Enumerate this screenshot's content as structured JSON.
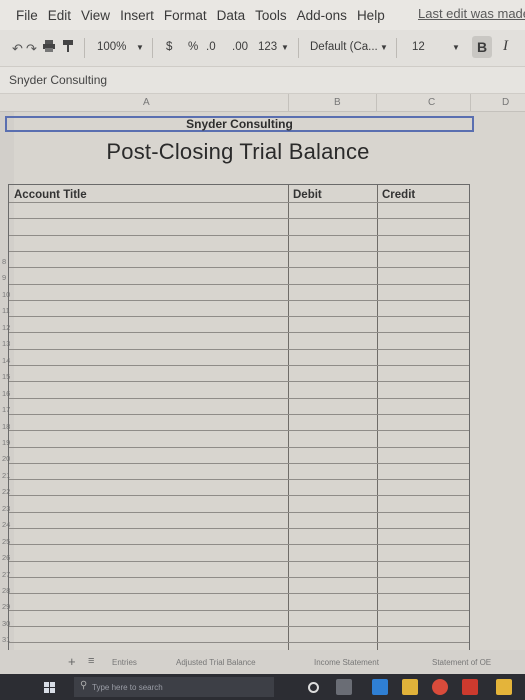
{
  "menu": {
    "items": [
      "File",
      "Edit",
      "View",
      "Insert",
      "Format",
      "Data",
      "Tools",
      "Add-ons",
      "Help"
    ],
    "last_edit": "Last edit was made"
  },
  "toolbar": {
    "zoom": "100%",
    "currency": "$",
    "percent": "%",
    "decrease_decimal": ".0",
    "increase_decimal": ".00",
    "number_format": "123",
    "font": "Default (Ca...",
    "font_size": "12",
    "bold": "B",
    "italic": "I"
  },
  "formula_bar": {
    "cell_content": "Snyder Consulting"
  },
  "columns": [
    "A",
    "B",
    "C",
    "D"
  ],
  "row_numbers": [
    "8",
    "9",
    "10",
    "11",
    "12",
    "13",
    "14",
    "15",
    "16",
    "17",
    "18",
    "19",
    "20",
    "21",
    "22",
    "23",
    "24",
    "25",
    "26",
    "27",
    "28",
    "29",
    "30",
    "31",
    "32",
    "33",
    "34",
    "35"
  ],
  "report": {
    "company": "Snyder Consulting",
    "title": "Post-Closing Trial Balance",
    "headers": {
      "account": "Account Title",
      "debit": "Debit",
      "credit": "Credit"
    }
  },
  "sheet_tabs": {
    "tabs": [
      "Entries",
      "Adjusted Trial Balance",
      "Income Statement",
      "Statement of OE"
    ]
  },
  "taskbar": {
    "search_placeholder": "Type here to search"
  },
  "colors": {
    "selection_border": "#5a6fb0",
    "taskbar": "#2c2d33"
  }
}
